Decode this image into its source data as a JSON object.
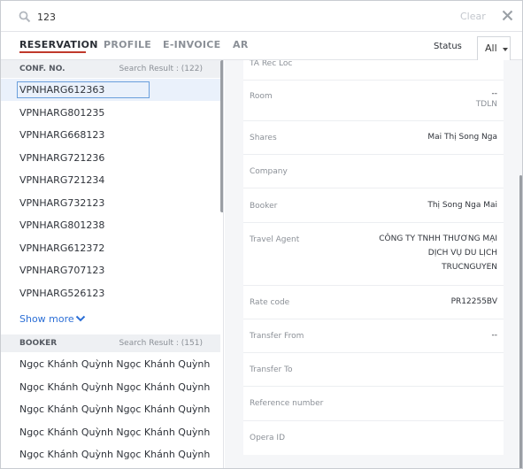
{
  "search": {
    "value": "123",
    "clear_label": "Clear"
  },
  "tabs": [
    {
      "label": "RESERVATION",
      "active": true
    },
    {
      "label": "PROFILE",
      "active": false
    },
    {
      "label": "E-INVOICE",
      "active": false
    },
    {
      "label": "AR",
      "active": false
    }
  ],
  "status": {
    "label": "Status",
    "selected": "All"
  },
  "reservations": {
    "header": "CONF. NO.",
    "count": "Search Result : (122)",
    "items": [
      "VPNHARG612363",
      "VPNHARG801235",
      "VPNHARG668123",
      "VPNHARG721236",
      "VPNHARG721234",
      "VPNHARG732123",
      "VPNHARG801238",
      "VPNHARG612372",
      "VPNHARG707123",
      "VPNHARG526123"
    ],
    "show_more": "Show more"
  },
  "bookers": {
    "header": "BOOKER",
    "count": "Search Result : (151)",
    "items": [
      "Ngọc Khánh Quỳnh Ngọc Khánh Quỳnh",
      "Ngọc Khánh Quỳnh Ngọc Khánh Quỳnh",
      "Ngọc Khánh Quỳnh Ngọc Khánh Quỳnh",
      "Ngọc Khánh Quỳnh Ngọc Khánh Quỳnh",
      "Ngọc Khánh Quỳnh Ngọc Khánh Quỳnh"
    ]
  },
  "details": {
    "ta_rec_loc": {
      "label": "TA Rec Loc",
      "value": ""
    },
    "room": {
      "label": "Room",
      "value": "--",
      "sub": "TDLN"
    },
    "shares": {
      "label": "Shares",
      "value": "Mai Thị Song Nga"
    },
    "company": {
      "label": "Company",
      "value": ""
    },
    "booker": {
      "label": "Booker",
      "value": "Thị Song Nga Mai"
    },
    "travel_agent": {
      "label": "Travel Agent",
      "line1": "CÔNG TY TNHH THƯƠNG MẠI",
      "line2": "DỊCH VỤ DU LỊCH",
      "line3": "TRUCNGUYEN"
    },
    "rate_code": {
      "label": "Rate code",
      "value": "PR12255BV"
    },
    "transfer_from": {
      "label": "Transfer From",
      "value": "--"
    },
    "transfer_to": {
      "label": "Transfer To",
      "value": ""
    },
    "reference_number": {
      "label": "Reference number",
      "value": ""
    },
    "opera_id": {
      "label": "Opera ID",
      "value": ""
    }
  },
  "colors": {
    "accent": "#c0392b",
    "link": "#2c6fd6",
    "selected_row": "#eaf1fb"
  }
}
